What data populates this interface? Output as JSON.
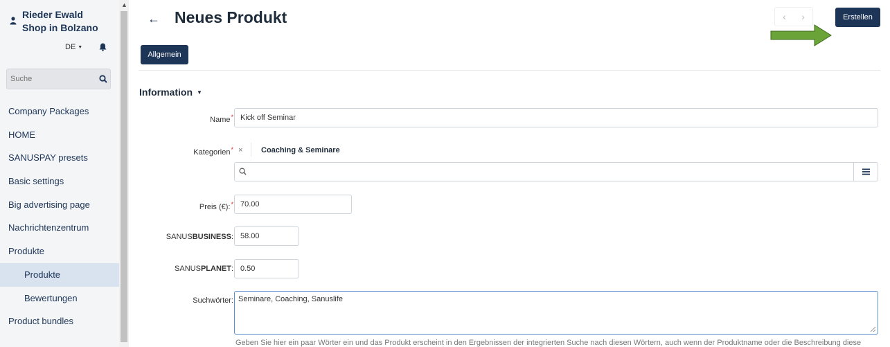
{
  "sidebar": {
    "user_line1": "Rieder Ewald",
    "user_line2": "Shop in Bolzano",
    "language": "DE",
    "search_placeholder": "Suche",
    "items": [
      {
        "label": "Company Packages"
      },
      {
        "label": "HOME"
      },
      {
        "label": "SANUSPAY presets"
      },
      {
        "label": "Basic settings"
      },
      {
        "label": "Big advertising page"
      },
      {
        "label": "Nachrichtenzentrum"
      },
      {
        "label": "Produkte"
      },
      {
        "label": "Produkte"
      },
      {
        "label": "Bewertungen"
      },
      {
        "label": "Product bundles"
      }
    ]
  },
  "header": {
    "title": "Neues Produkt",
    "create_label": "Erstellen",
    "prev_glyph": "‹",
    "next_glyph": "›",
    "back_glyph": "←"
  },
  "tabs": {
    "general_label": "Allgemein"
  },
  "section": {
    "title": "Information"
  },
  "form": {
    "name_label": "Name",
    "name_value": "Kick off Seminar",
    "categories_label": "Kategorien",
    "category_tag": "Coaching & Seminare",
    "category_remove": "×",
    "price_label": "Preis (€):",
    "price_value": "70.00",
    "business_label_prefix": "SANUS",
    "business_label_bold": "BUSINESS",
    "business_label_suffix": ":",
    "business_value": "58.00",
    "planet_label_prefix": "SANUS",
    "planet_label_bold": "PLANET",
    "planet_label_suffix": ":",
    "planet_value": "0.50",
    "keywords_label": "Suchwörter:",
    "keywords_value": "Seminare, Coaching, Sanuslife",
    "keywords_help": "Geben Sie hier ein paar Wörter ein und das Produkt erscheint in den Ergebnissen der integrierten Suche nach diesen Wörtern, auch wenn der Produktname oder die Beschreibung diese"
  },
  "colors": {
    "primary": "#1d3557",
    "annotation_arrow": "#6aa338",
    "required": "#d0342c"
  },
  "icons": {
    "user": "user-icon",
    "bell": "bell-icon",
    "search": "search-icon",
    "menu": "hamburger-icon",
    "arrow": "green-annotation-arrow"
  }
}
